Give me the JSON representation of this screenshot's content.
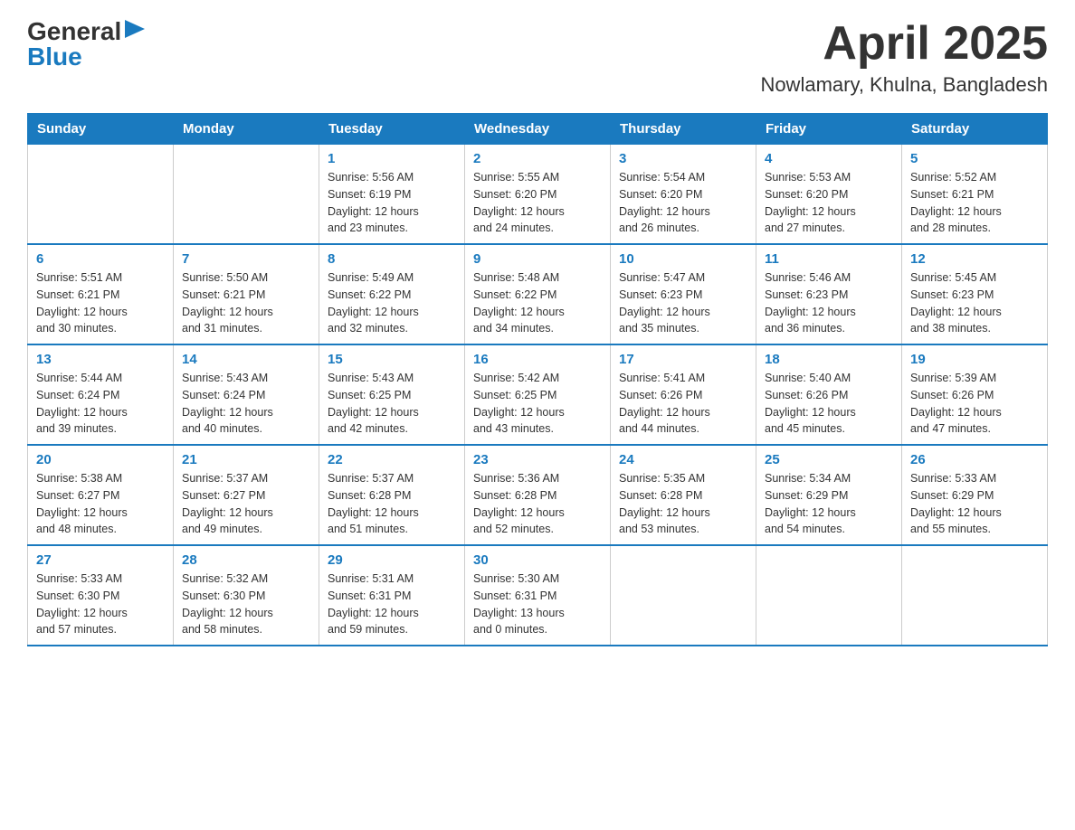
{
  "logo": {
    "general": "General",
    "blue": "Blue"
  },
  "header": {
    "month": "April 2025",
    "location": "Nowlamary, Khulna, Bangladesh"
  },
  "weekdays": [
    "Sunday",
    "Monday",
    "Tuesday",
    "Wednesday",
    "Thursday",
    "Friday",
    "Saturday"
  ],
  "weeks": [
    [
      {
        "day": "",
        "info": ""
      },
      {
        "day": "",
        "info": ""
      },
      {
        "day": "1",
        "info": "Sunrise: 5:56 AM\nSunset: 6:19 PM\nDaylight: 12 hours\nand 23 minutes."
      },
      {
        "day": "2",
        "info": "Sunrise: 5:55 AM\nSunset: 6:20 PM\nDaylight: 12 hours\nand 24 minutes."
      },
      {
        "day": "3",
        "info": "Sunrise: 5:54 AM\nSunset: 6:20 PM\nDaylight: 12 hours\nand 26 minutes."
      },
      {
        "day": "4",
        "info": "Sunrise: 5:53 AM\nSunset: 6:20 PM\nDaylight: 12 hours\nand 27 minutes."
      },
      {
        "day": "5",
        "info": "Sunrise: 5:52 AM\nSunset: 6:21 PM\nDaylight: 12 hours\nand 28 minutes."
      }
    ],
    [
      {
        "day": "6",
        "info": "Sunrise: 5:51 AM\nSunset: 6:21 PM\nDaylight: 12 hours\nand 30 minutes."
      },
      {
        "day": "7",
        "info": "Sunrise: 5:50 AM\nSunset: 6:21 PM\nDaylight: 12 hours\nand 31 minutes."
      },
      {
        "day": "8",
        "info": "Sunrise: 5:49 AM\nSunset: 6:22 PM\nDaylight: 12 hours\nand 32 minutes."
      },
      {
        "day": "9",
        "info": "Sunrise: 5:48 AM\nSunset: 6:22 PM\nDaylight: 12 hours\nand 34 minutes."
      },
      {
        "day": "10",
        "info": "Sunrise: 5:47 AM\nSunset: 6:23 PM\nDaylight: 12 hours\nand 35 minutes."
      },
      {
        "day": "11",
        "info": "Sunrise: 5:46 AM\nSunset: 6:23 PM\nDaylight: 12 hours\nand 36 minutes."
      },
      {
        "day": "12",
        "info": "Sunrise: 5:45 AM\nSunset: 6:23 PM\nDaylight: 12 hours\nand 38 minutes."
      }
    ],
    [
      {
        "day": "13",
        "info": "Sunrise: 5:44 AM\nSunset: 6:24 PM\nDaylight: 12 hours\nand 39 minutes."
      },
      {
        "day": "14",
        "info": "Sunrise: 5:43 AM\nSunset: 6:24 PM\nDaylight: 12 hours\nand 40 minutes."
      },
      {
        "day": "15",
        "info": "Sunrise: 5:43 AM\nSunset: 6:25 PM\nDaylight: 12 hours\nand 42 minutes."
      },
      {
        "day": "16",
        "info": "Sunrise: 5:42 AM\nSunset: 6:25 PM\nDaylight: 12 hours\nand 43 minutes."
      },
      {
        "day": "17",
        "info": "Sunrise: 5:41 AM\nSunset: 6:26 PM\nDaylight: 12 hours\nand 44 minutes."
      },
      {
        "day": "18",
        "info": "Sunrise: 5:40 AM\nSunset: 6:26 PM\nDaylight: 12 hours\nand 45 minutes."
      },
      {
        "day": "19",
        "info": "Sunrise: 5:39 AM\nSunset: 6:26 PM\nDaylight: 12 hours\nand 47 minutes."
      }
    ],
    [
      {
        "day": "20",
        "info": "Sunrise: 5:38 AM\nSunset: 6:27 PM\nDaylight: 12 hours\nand 48 minutes."
      },
      {
        "day": "21",
        "info": "Sunrise: 5:37 AM\nSunset: 6:27 PM\nDaylight: 12 hours\nand 49 minutes."
      },
      {
        "day": "22",
        "info": "Sunrise: 5:37 AM\nSunset: 6:28 PM\nDaylight: 12 hours\nand 51 minutes."
      },
      {
        "day": "23",
        "info": "Sunrise: 5:36 AM\nSunset: 6:28 PM\nDaylight: 12 hours\nand 52 minutes."
      },
      {
        "day": "24",
        "info": "Sunrise: 5:35 AM\nSunset: 6:28 PM\nDaylight: 12 hours\nand 53 minutes."
      },
      {
        "day": "25",
        "info": "Sunrise: 5:34 AM\nSunset: 6:29 PM\nDaylight: 12 hours\nand 54 minutes."
      },
      {
        "day": "26",
        "info": "Sunrise: 5:33 AM\nSunset: 6:29 PM\nDaylight: 12 hours\nand 55 minutes."
      }
    ],
    [
      {
        "day": "27",
        "info": "Sunrise: 5:33 AM\nSunset: 6:30 PM\nDaylight: 12 hours\nand 57 minutes."
      },
      {
        "day": "28",
        "info": "Sunrise: 5:32 AM\nSunset: 6:30 PM\nDaylight: 12 hours\nand 58 minutes."
      },
      {
        "day": "29",
        "info": "Sunrise: 5:31 AM\nSunset: 6:31 PM\nDaylight: 12 hours\nand 59 minutes."
      },
      {
        "day": "30",
        "info": "Sunrise: 5:30 AM\nSunset: 6:31 PM\nDaylight: 13 hours\nand 0 minutes."
      },
      {
        "day": "",
        "info": ""
      },
      {
        "day": "",
        "info": ""
      },
      {
        "day": "",
        "info": ""
      }
    ]
  ]
}
